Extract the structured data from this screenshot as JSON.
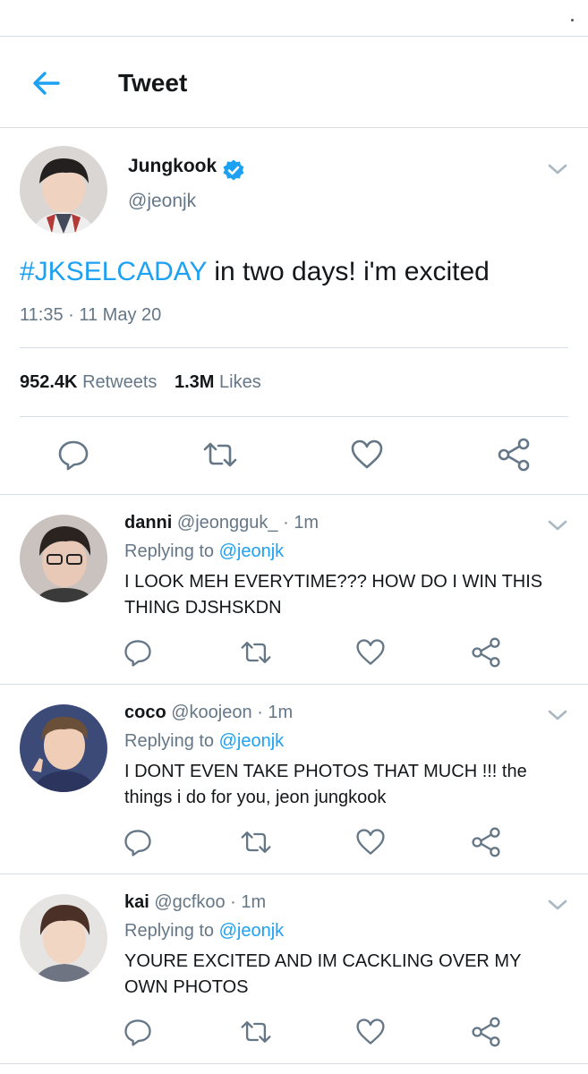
{
  "header": {
    "title": "Tweet"
  },
  "tweet": {
    "author_name": "Jungkook",
    "author_handle": "@jeonjk",
    "verified": true,
    "hashtag": "#JKSELCADAY",
    "text": " in two days! i'm excited",
    "timestamp": "11:35 · 11 May 20",
    "retweet_count": "952.4K",
    "retweet_label": "Retweets",
    "like_count": "1.3M",
    "like_label": "Likes"
  },
  "replies": [
    {
      "name": "danni",
      "handle": "@jeongguk_",
      "separator": "·",
      "time": "1m",
      "replying_prefix": "Replying to",
      "replying_to": "@jeonjk",
      "text": "I LOOK MEH EVERYTIME??? HOW DO I WIN THIS THING DJSHSKDN"
    },
    {
      "name": "coco",
      "handle": "@koojeon",
      "separator": "·",
      "time": "1m",
      "replying_prefix": "Replying to",
      "replying_to": "@jeonjk",
      "text": "I DONT EVEN TAKE PHOTOS THAT MUCH !!! the things i do for you, jeon jungkook"
    },
    {
      "name": "kai",
      "handle": "@gcfkoo",
      "separator": "·",
      "time": "1m",
      "replying_prefix": "Replying to",
      "replying_to": "@jeonjk",
      "text": "YOURE EXCITED AND IM CACKLING OVER MY OWN PHOTOS"
    }
  ],
  "icons": {
    "back": "arrow-left-icon",
    "verified": "verified-badge-icon",
    "caret": "chevron-down-icon",
    "reply": "reply-icon",
    "retweet": "retweet-icon",
    "like": "heart-icon",
    "share": "share-icon"
  },
  "colors": {
    "accent": "#1da1f2",
    "text": "#14171a",
    "secondary": "#657786",
    "border": "#d6dde4"
  }
}
